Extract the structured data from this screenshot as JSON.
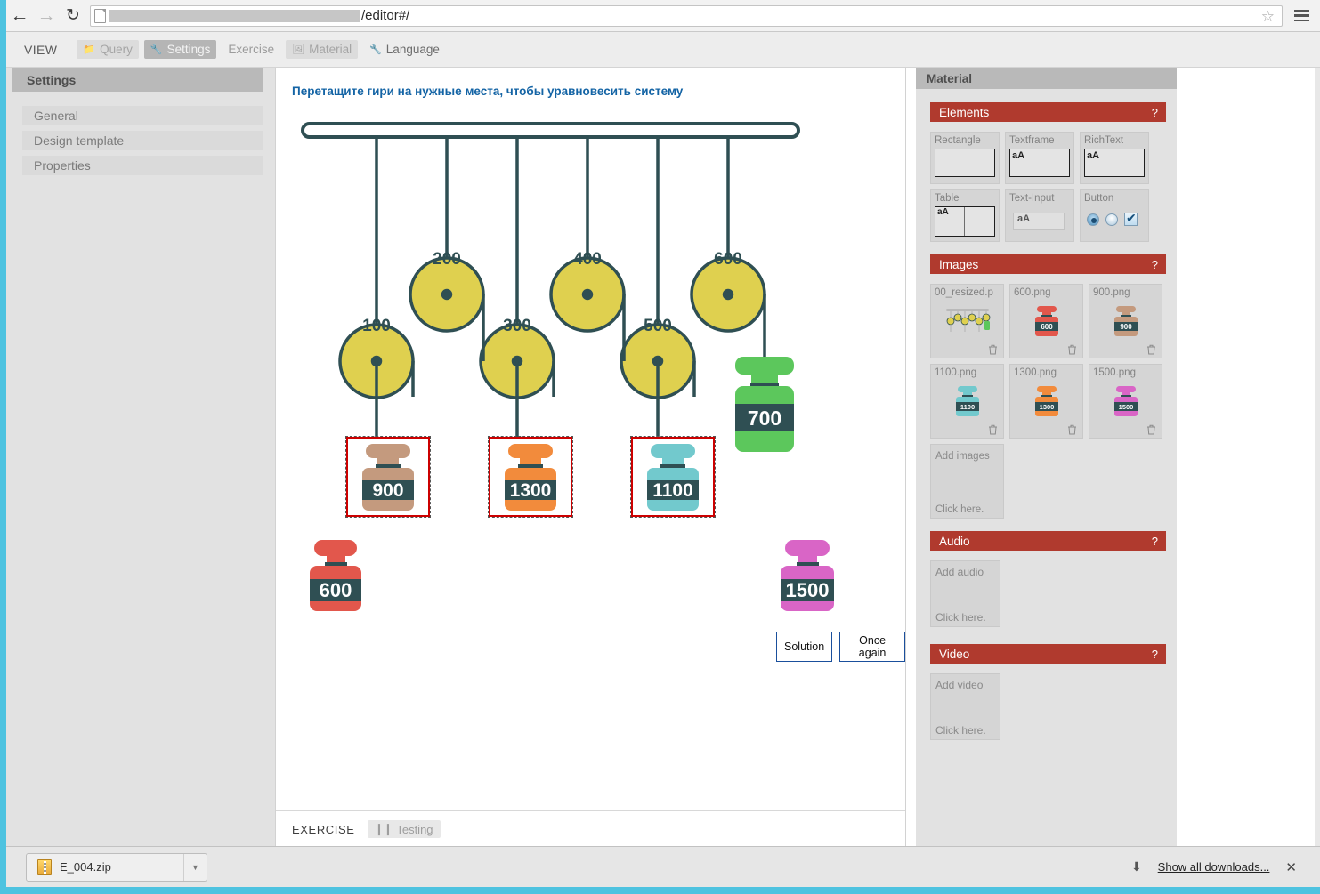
{
  "browser": {
    "back_icon": "back-arrow-icon",
    "forward_icon": "forward-arrow-icon",
    "reload_icon": "reload-icon",
    "url_text": "/editor#/",
    "bookmark_icon": "star-icon",
    "menu_icon": "hamburger-menu-icon"
  },
  "toolbar": {
    "brand": "VIEW",
    "buttons": [
      {
        "label": "Query",
        "icon": "folder-icon",
        "state": "dim"
      },
      {
        "label": "Settings",
        "icon": "wrench-icon",
        "state": "active"
      },
      {
        "label": "Exercise",
        "icon": "",
        "state": "plain"
      },
      {
        "label": "Material",
        "icon": "image-icon",
        "state": "dim"
      },
      {
        "label": "Language",
        "icon": "wrench-icon",
        "state": "lang"
      }
    ]
  },
  "settings": {
    "header": "Settings",
    "items": [
      {
        "label": "General"
      },
      {
        "label": "Design template"
      },
      {
        "label": "Properties"
      }
    ]
  },
  "exercise": {
    "title": "Перетащите гири на нужные места, чтобы уравновесить систему",
    "pulleys": [
      {
        "label": "100"
      },
      {
        "label": "200"
      },
      {
        "label": "300"
      },
      {
        "label": "400"
      },
      {
        "label": "500"
      },
      {
        "label": "600"
      }
    ],
    "hanging_weight": {
      "label": "700",
      "color": "#5cc75c"
    },
    "placed_weights": [
      {
        "label": "900",
        "color": "#c49a7e"
      },
      {
        "label": "1300",
        "color": "#f28b3c"
      },
      {
        "label": "1100",
        "color": "#72c9cd"
      }
    ],
    "loose_weights": [
      {
        "label": "600",
        "color": "#e2574c"
      },
      {
        "label": "1500",
        "color": "#d965c6"
      }
    ],
    "solution_button": "Solution",
    "once_again_button": "Once again",
    "footer_label": "EXERCISE",
    "testing_button": "Testing",
    "testing_icon": "pause-icon"
  },
  "material": {
    "header": "Material",
    "sections": {
      "elements": {
        "title": "Elements",
        "help": "?",
        "tiles": [
          {
            "label": "Rectangle",
            "kind": "rect"
          },
          {
            "label": "Textframe",
            "kind": "text",
            "sample": "aA"
          },
          {
            "label": "RichText",
            "kind": "text",
            "sample": "aA"
          },
          {
            "label": "Table",
            "kind": "table",
            "sample": "aA"
          },
          {
            "label": "Text-Input",
            "kind": "input",
            "sample": "aA"
          },
          {
            "label": "Button",
            "kind": "button"
          }
        ]
      },
      "images": {
        "title": "Images",
        "help": "?",
        "tiles": [
          {
            "label": "00_resized.p",
            "thumb": "scale",
            "delete_icon": "trash-icon"
          },
          {
            "label": "600.png",
            "thumb": "weight",
            "color": "#e2574c",
            "value": "600",
            "delete_icon": "trash-icon"
          },
          {
            "label": "900.png",
            "thumb": "weight",
            "color": "#c49a7e",
            "value": "900",
            "delete_icon": "trash-icon"
          },
          {
            "label": "1100.png",
            "thumb": "weight",
            "color": "#72c9cd",
            "value": "1100",
            "delete_icon": "trash-icon"
          },
          {
            "label": "1300.png",
            "thumb": "weight",
            "color": "#f28b3c",
            "value": "1300",
            "delete_icon": "trash-icon"
          },
          {
            "label": "1500.png",
            "thumb": "weight",
            "color": "#d965c6",
            "value": "1500",
            "delete_icon": "trash-icon"
          }
        ],
        "add_title": "Add images",
        "add_hint": "Click here."
      },
      "audio": {
        "title": "Audio",
        "help": "?",
        "add_title": "Add audio",
        "add_hint": "Click here."
      },
      "video": {
        "title": "Video",
        "help": "?",
        "add_title": "Add video",
        "add_hint": "Click here."
      }
    }
  },
  "downloads": {
    "file_name": "E_004.zip",
    "file_icon": "zip-file-icon",
    "caret_icon": "chevron-down-icon",
    "show_all": "Show all downloads...",
    "down_icon": "download-arrow-icon",
    "close_icon": "close-icon"
  },
  "colors": {
    "accent_red": "#b03a2e",
    "pulley_yellow": "#dfd04f",
    "frame_dark": "#2f4f53",
    "title_blue": "#1464a5"
  }
}
